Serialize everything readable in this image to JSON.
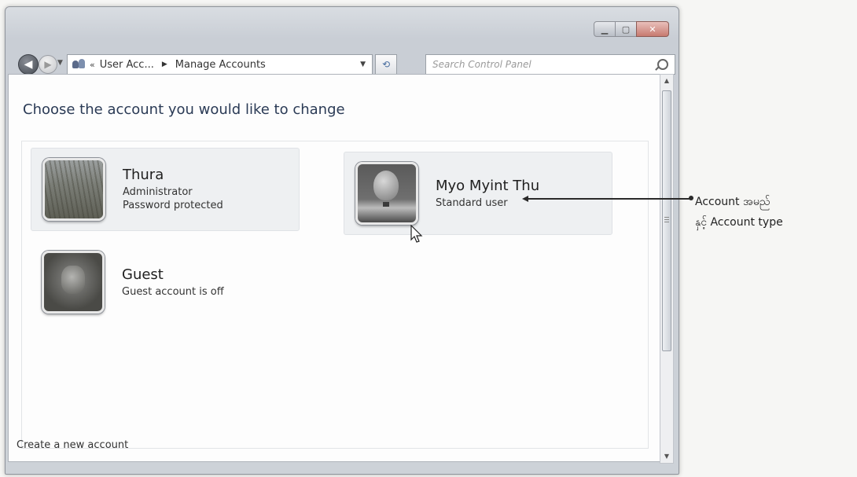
{
  "nav": {
    "breadcrumb_prefix": "«",
    "breadcrumb_parent": "User Acc...",
    "breadcrumb_current": "Manage Accounts",
    "search_placeholder": "Search Control Panel"
  },
  "main": {
    "heading": "Choose the account you would like to change",
    "accounts": [
      {
        "name": "Thura",
        "line1": "Administrator",
        "line2": "Password protected",
        "picture": "wheat-icon"
      },
      {
        "name": "Myo Myint Thu",
        "line1": "Standard user",
        "picture": "balloon-icon"
      },
      {
        "name": "Guest",
        "line1": "Guest account is off",
        "picture": "guest-icon"
      }
    ],
    "create_link": "Create a new account"
  },
  "annotation": {
    "line1": "Account အမည်",
    "line2": "နှင့် Account type"
  }
}
